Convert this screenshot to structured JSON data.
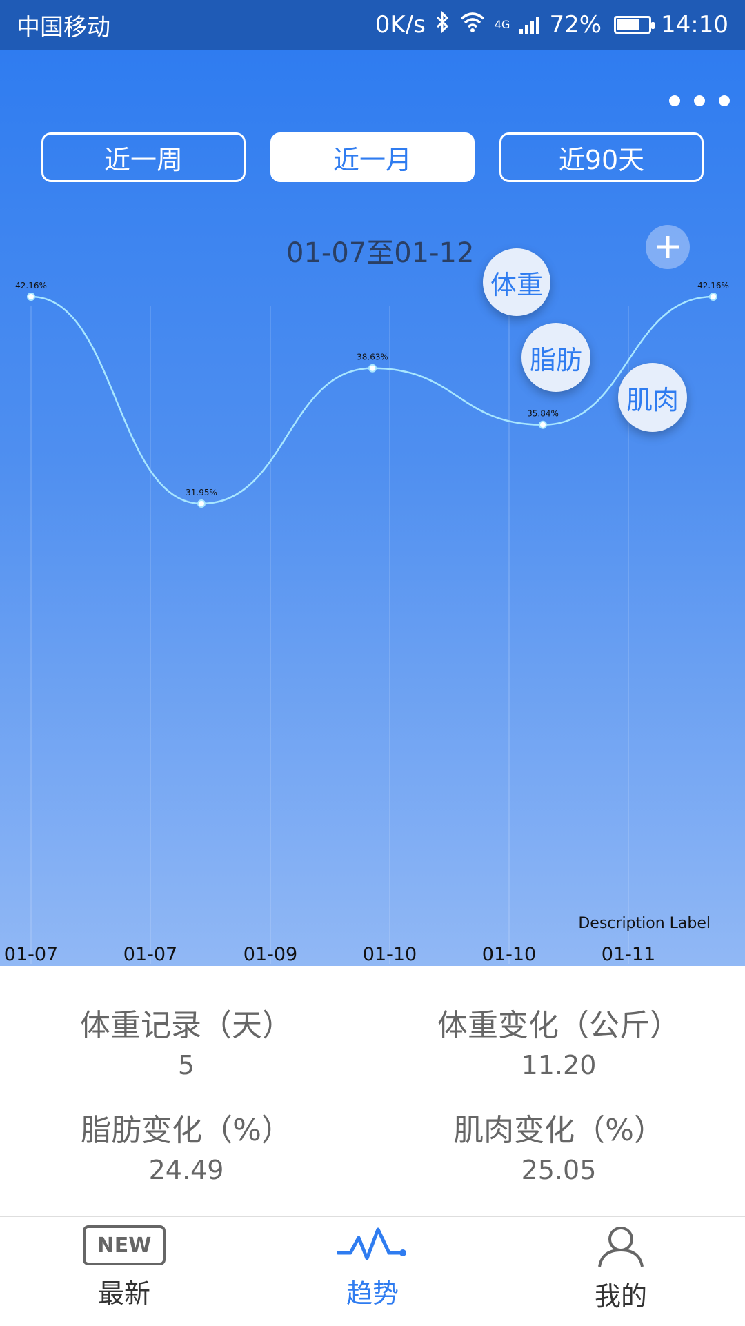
{
  "status_bar": {
    "carrier": "中国移动",
    "net_speed": "0K/s",
    "network_type": "4G",
    "battery": "72%",
    "battery_level": 0.72,
    "time": "14:10"
  },
  "segments": [
    {
      "label": "近一周",
      "active": false
    },
    {
      "label": "近一月",
      "active": true
    },
    {
      "label": "近90天",
      "active": false
    }
  ],
  "date_range": "01-07至01-12",
  "metric_bubbles": {
    "weight": "体重",
    "fat": "脂肪",
    "muscle": "肌肉"
  },
  "chart_data": {
    "type": "line",
    "x": [
      "01-07",
      "01-07",
      "01-09",
      "01-10",
      "01-10",
      "01-11"
    ],
    "point_labels": [
      "42.16%",
      "31.95%",
      "38.63%",
      "35.84%",
      "42.16%"
    ],
    "values": [
      42.16,
      31.95,
      38.63,
      35.84,
      42.16
    ],
    "xlabel": "",
    "ylabel": "",
    "description": "Description Label",
    "grid": true,
    "line_color": "#a8e6ff"
  },
  "stats": {
    "weight_days": {
      "label": "体重记录（天）",
      "value": "5"
    },
    "weight_change": {
      "label": "体重变化（公斤）",
      "value": "11.20"
    },
    "fat_change": {
      "label": "脂肪变化（%）",
      "value": "24.49"
    },
    "muscle_change": {
      "label": "肌肉变化（%）",
      "value": "25.05"
    }
  },
  "bottom_nav": {
    "new_badge": "NEW",
    "items": [
      {
        "label": "最新",
        "icon": "new-icon"
      },
      {
        "label": "趋势",
        "icon": "trend-icon",
        "active": true
      },
      {
        "label": "我的",
        "icon": "user-icon"
      }
    ]
  },
  "colors": {
    "accent": "#2f7cf0",
    "status_bar": "#1f5bb6"
  }
}
